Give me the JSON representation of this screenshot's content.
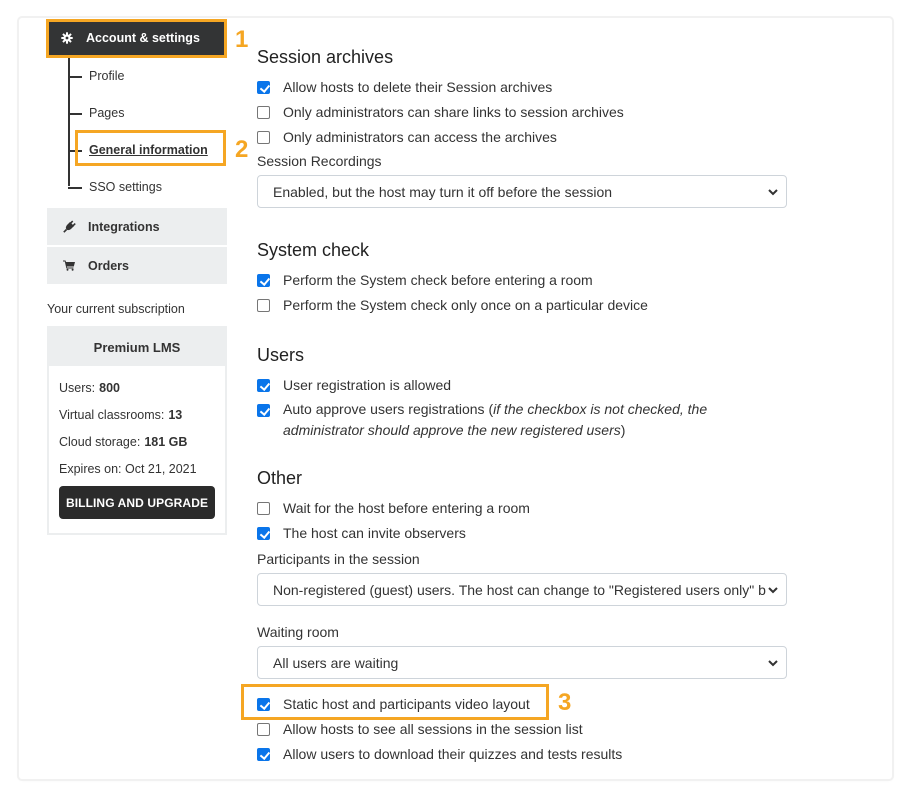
{
  "sidebar": {
    "main_item": {
      "label": "Account & settings",
      "icon": "gear-icon"
    },
    "tree_items": [
      {
        "label": "Profile",
        "active": false
      },
      {
        "label": "Pages",
        "active": false
      },
      {
        "label": "General information",
        "active": true
      },
      {
        "label": "SSO settings",
        "active": false
      }
    ],
    "sub_items": [
      {
        "label": "Integrations",
        "icon": "plug-icon"
      },
      {
        "label": "Orders",
        "icon": "cart-icon"
      }
    ],
    "subscription": {
      "title": "Your current subscription",
      "plan": "Premium LMS",
      "rows": [
        {
          "label": "Users:",
          "value": "800"
        },
        {
          "label": "Virtual classrooms:",
          "value": "13"
        },
        {
          "label": "Cloud storage:",
          "value": "181 GB"
        },
        {
          "label": "Expires on: Oct 21, 2021",
          "value": ""
        }
      ],
      "button": "BILLING AND UPGRADE"
    }
  },
  "annotations": [
    "1",
    "2",
    "3"
  ],
  "annotation_color": "#f5a623",
  "checkbox_color": "#0a75ea",
  "main": {
    "session_archives": {
      "title": "Session archives",
      "options": [
        {
          "label": "Allow hosts to delete their Session archives",
          "checked": true
        },
        {
          "label": "Only administrators can share links to session archives",
          "checked": false
        },
        {
          "label": "Only administrators can access the archives",
          "checked": false
        }
      ],
      "recordings_label": "Session Recordings",
      "recordings_value": "Enabled, but the host may turn it off before the session"
    },
    "system_check": {
      "title": "System check",
      "options": [
        {
          "label": "Perform the System check before entering a room",
          "checked": true
        },
        {
          "label": "Perform the System check only once on a particular device",
          "checked": false
        }
      ]
    },
    "users": {
      "title": "Users",
      "options": [
        {
          "label": "User registration is allowed",
          "checked": true
        },
        {
          "label": "Auto approve users registrations (",
          "note": "if the checkbox is not checked, the administrator should approve the new registered users",
          "suffix": ")",
          "checked": true
        }
      ]
    },
    "other": {
      "title": "Other",
      "options": [
        {
          "label": "Wait for the host before entering a room",
          "checked": false
        },
        {
          "label": "The host can invite observers",
          "checked": true
        }
      ],
      "participants_label": "Participants in the session",
      "participants_value": "Non-registered (guest) users. The host can change to \"Registered users only\" b",
      "waiting_label": "Waiting room",
      "waiting_value": "All users are waiting",
      "options_after": [
        {
          "label": "Static host and participants video layout",
          "checked": true
        },
        {
          "label": "Allow hosts to see all sessions in the session list",
          "checked": false
        },
        {
          "label": "Allow users to download their quizzes and tests results",
          "checked": true
        }
      ]
    }
  }
}
